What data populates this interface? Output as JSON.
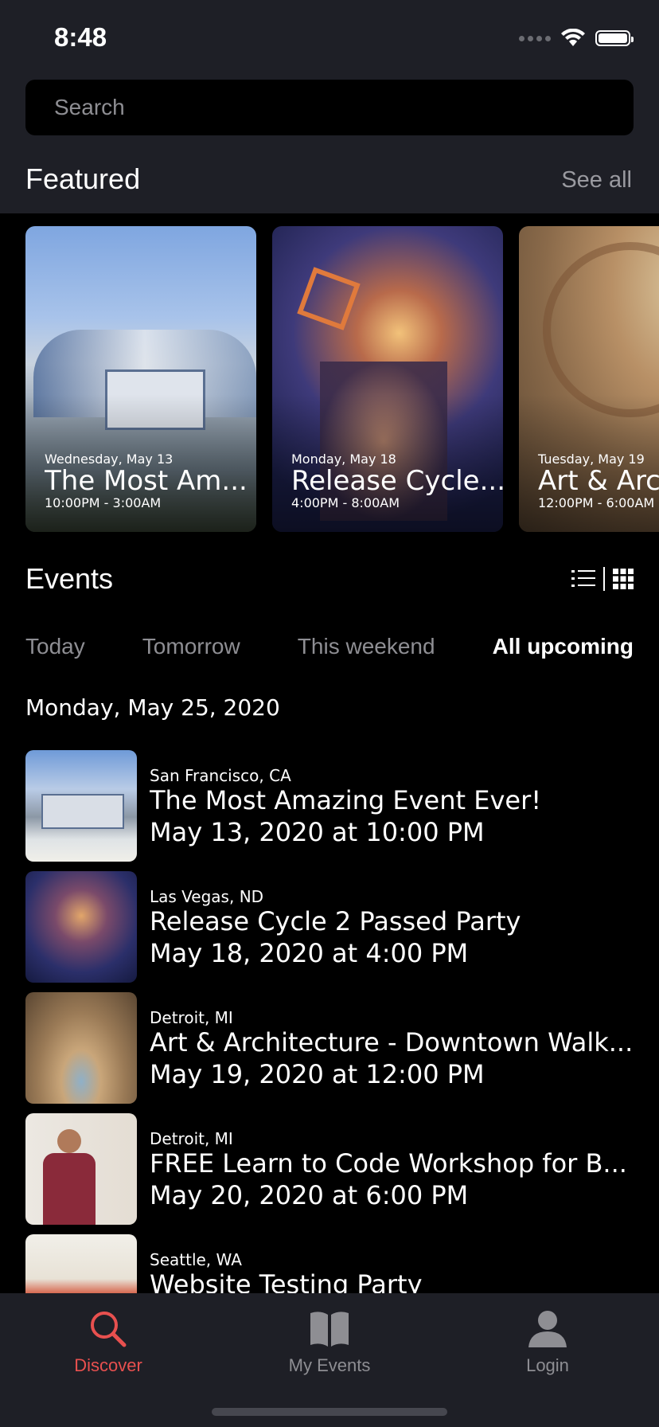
{
  "status_bar": {
    "time": "8:48"
  },
  "search": {
    "placeholder": "Search"
  },
  "featured": {
    "title": "Featured",
    "see_all": "See all",
    "cards": [
      {
        "date": "Wednesday, May 13",
        "title": "The Most Am...",
        "time": "10:00PM - 3:00AM"
      },
      {
        "date": "Monday, May 18",
        "title": "Release Cycle...",
        "time": "4:00PM - 8:00AM"
      },
      {
        "date": "Tuesday, May 19",
        "title": "Art & Arch",
        "time": "12:00PM - 6:00AM"
      }
    ]
  },
  "events": {
    "title": "Events",
    "tabs": [
      "Today",
      "Tomorrow",
      "This weekend",
      "All upcoming"
    ],
    "active_tab": "All upcoming",
    "date_heading": "Monday, May 25, 2020",
    "items": [
      {
        "location": "San Francisco, CA",
        "name": "The Most Amazing Event Ever!",
        "when": "May 13, 2020 at 10:00 PM"
      },
      {
        "location": "Las Vegas, ND",
        "name": "Release Cycle 2 Passed Party",
        "when": "May 18, 2020 at 4:00 PM"
      },
      {
        "location": "Detroit, MI",
        "name": "Art & Architecture - Downtown Walk...",
        "when": "May 19, 2020 at 12:00 PM"
      },
      {
        "location": "Detroit, MI",
        "name": "FREE Learn to Code Workshop for B...",
        "when": "May 20, 2020 at 6:00 PM"
      },
      {
        "location": "Seattle, WA",
        "name": "Website Testing Party",
        "when": ""
      }
    ]
  },
  "tabbar": {
    "discover": "Discover",
    "my_events": "My Events",
    "login": "Login"
  },
  "colors": {
    "accent": "#e8504f",
    "header_bg": "#1e1f26",
    "muted": "#8e8e93"
  }
}
